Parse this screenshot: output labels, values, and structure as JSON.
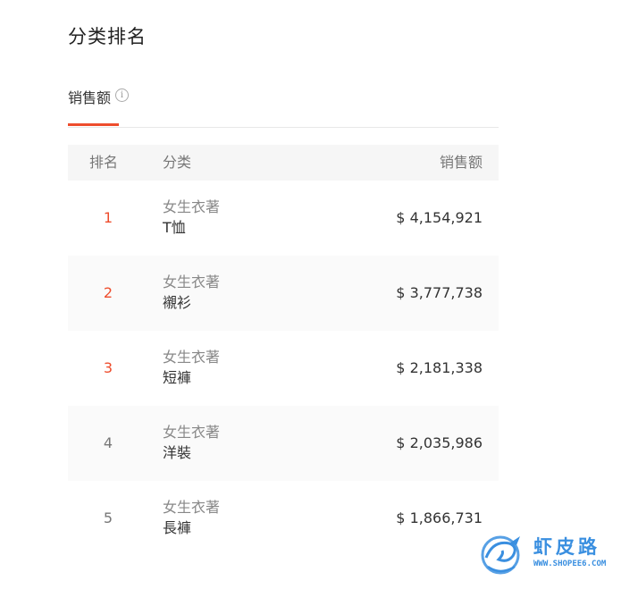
{
  "page": {
    "title": "分类排名"
  },
  "tabs": [
    {
      "label": "销售额",
      "active": true,
      "info_icon": "info-icon"
    }
  ],
  "table": {
    "headers": {
      "rank": "排名",
      "category": "分类",
      "sales": "销售额"
    },
    "rows": [
      {
        "rank": "1",
        "parent": "女生衣著",
        "child": "T恤",
        "sales": "$ 4,154,921",
        "highlight": true
      },
      {
        "rank": "2",
        "parent": "女生衣著",
        "child": "襯衫",
        "sales": "$ 3,777,738",
        "highlight": true
      },
      {
        "rank": "3",
        "parent": "女生衣著",
        "child": "短褲",
        "sales": "$ 2,181,338",
        "highlight": true
      },
      {
        "rank": "4",
        "parent": "女生衣著",
        "child": "洋裝",
        "sales": "$ 2,035,986",
        "highlight": false
      },
      {
        "rank": "5",
        "parent": "女生衣著",
        "child": "長褲",
        "sales": "$ 1,866,731",
        "highlight": false
      }
    ]
  },
  "watermark": {
    "text": "虾皮路",
    "url": "WWW.SHOPEE6.COM"
  },
  "colors": {
    "accent": "#ee4d2d",
    "header_bg": "#f6f6f6",
    "watermark": "#3a8fe0"
  }
}
